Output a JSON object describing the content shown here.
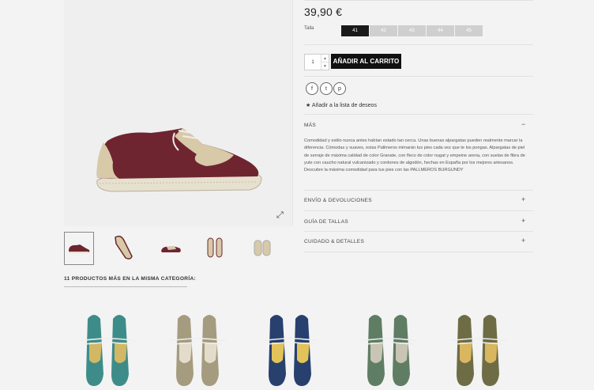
{
  "product": {
    "price": "39,90 €",
    "size_label": "Talla",
    "sizes": [
      "41",
      "42",
      "43",
      "44",
      "45"
    ],
    "selected_size": "41",
    "quantity": "1",
    "add_to_cart": "AÑADIR AL CARRITO",
    "wishlist": "Añadir a la lista de deseos",
    "shoe_colors": {
      "upper": "#6e2530",
      "wing": "#d8c9a8",
      "sole": "#e6e0cf"
    }
  },
  "social": [
    "facebook-icon",
    "twitter-icon",
    "pinterest-icon"
  ],
  "accordion": {
    "mas": {
      "title": "MÁS",
      "sign": "−",
      "text": "Comodidad y estilo nunca antes habían estado tan cerca. Unas buenas alpargatas pueden realmente marcar la diferencia. Cómodas y suaves, estas Pallmeros mimarán tus pies cada vez que te los pongas. Alpargatas de piel de serraje de máxima calidad de color Granate, con fleco de color nugat y empeine arena, con suelas de fibra de yute con caucho natural vulcanizado y cordones de algodón, hechas en España por los mejores artesanos. Descubre la máxima comodidad para tus pies con las PALLMEROS BURGUNDY"
    },
    "envio": {
      "title": "ENVÍO & DEVOLUCIONES",
      "sign": "+"
    },
    "guia": {
      "title": "GUÍA DE TALLAS",
      "sign": "+"
    },
    "cuidado": {
      "title": "CUIDADO & DETALLES",
      "sign": "+"
    }
  },
  "related": {
    "title": "11 PRODUCTOS MÁS EN LA MISMA CATEGORÍA:",
    "items": [
      {
        "upper": "#3e8c8a",
        "wing": "#d2b864"
      },
      {
        "upper": "#a59b7f",
        "wing": "#e4dccb"
      },
      {
        "upper": "#27406e",
        "wing": "#e2c35a"
      },
      {
        "upper": "#5f7d63",
        "wing": "#c9c4b3"
      },
      {
        "upper": "#6e6c45",
        "wing": "#d9b660"
      }
    ]
  }
}
